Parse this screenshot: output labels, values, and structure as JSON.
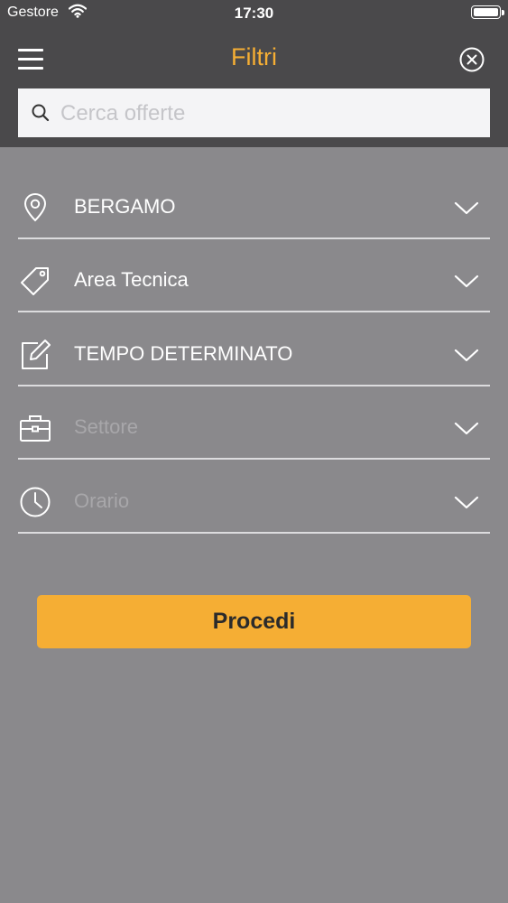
{
  "status_bar": {
    "carrier": "Gestore",
    "time": "17:30"
  },
  "header": {
    "title": "Filtri",
    "title_color": "#f5ae34",
    "menu_icon": "hamburger-icon",
    "close_icon": "close-circle-icon"
  },
  "search": {
    "placeholder": "Cerca offerte",
    "value": ""
  },
  "filters": [
    {
      "icon": "location-pin-icon",
      "label": "BERGAMO",
      "is_placeholder": false
    },
    {
      "icon": "tag-icon",
      "label": "Area Tecnica",
      "is_placeholder": false
    },
    {
      "icon": "edit-icon",
      "label": "TEMPO DETERMINATO",
      "is_placeholder": false
    },
    {
      "icon": "briefcase-icon",
      "label": "Settore",
      "is_placeholder": true
    },
    {
      "icon": "clock-icon",
      "label": "Orario",
      "is_placeholder": true
    }
  ],
  "actions": {
    "proceed_label": "Procedi",
    "proceed_color": "#f5ae34"
  }
}
